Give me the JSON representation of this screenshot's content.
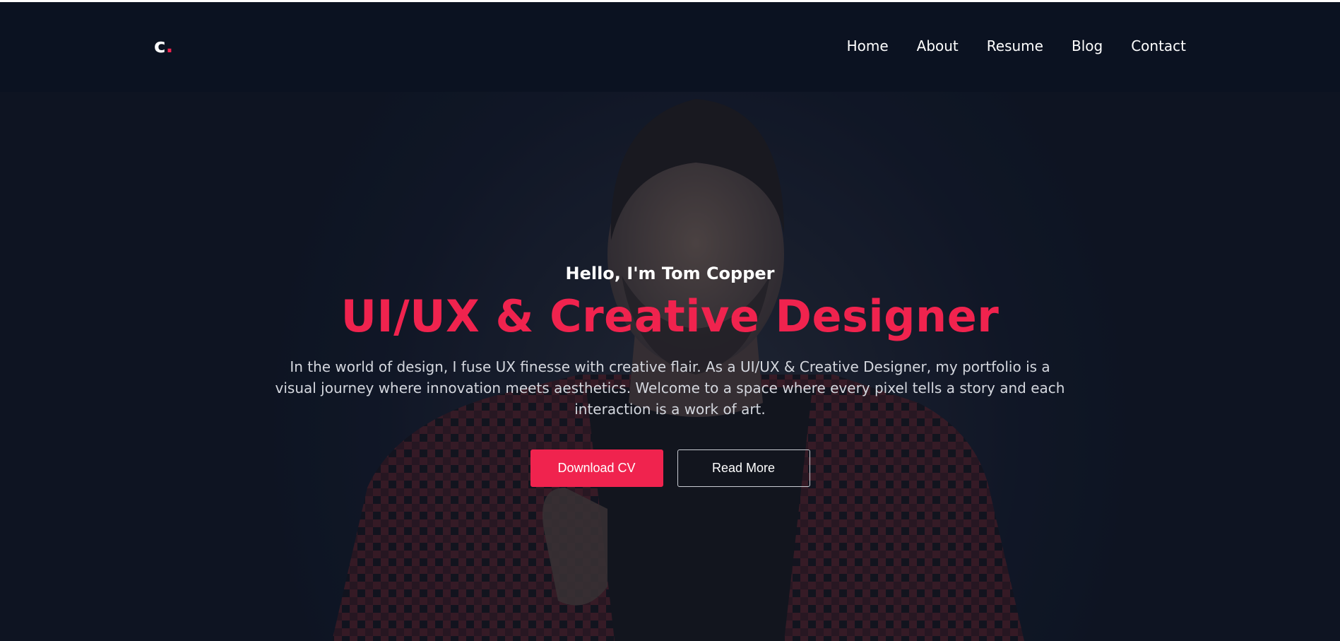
{
  "brand": {
    "logo_letter": "c",
    "logo_dot": ".",
    "accent_color": "#f0234e",
    "background_color": "#0b1221"
  },
  "nav": {
    "items": [
      {
        "label": "Home"
      },
      {
        "label": "About"
      },
      {
        "label": "Resume"
      },
      {
        "label": "Blog"
      },
      {
        "label": "Contact"
      }
    ]
  },
  "hero": {
    "greeting": "Hello, I'm Tom Copper",
    "title": "UI/UX & Creative Designer",
    "description": "In the world of design, I fuse UX finesse with creative flair. As a UI/UX & Creative Designer, my portfolio is a visual journey where innovation meets aesthetics. Welcome to a space where every pixel tells a story and each interaction is a work of art.",
    "primary_button": "Download CV",
    "secondary_button": "Read More"
  }
}
